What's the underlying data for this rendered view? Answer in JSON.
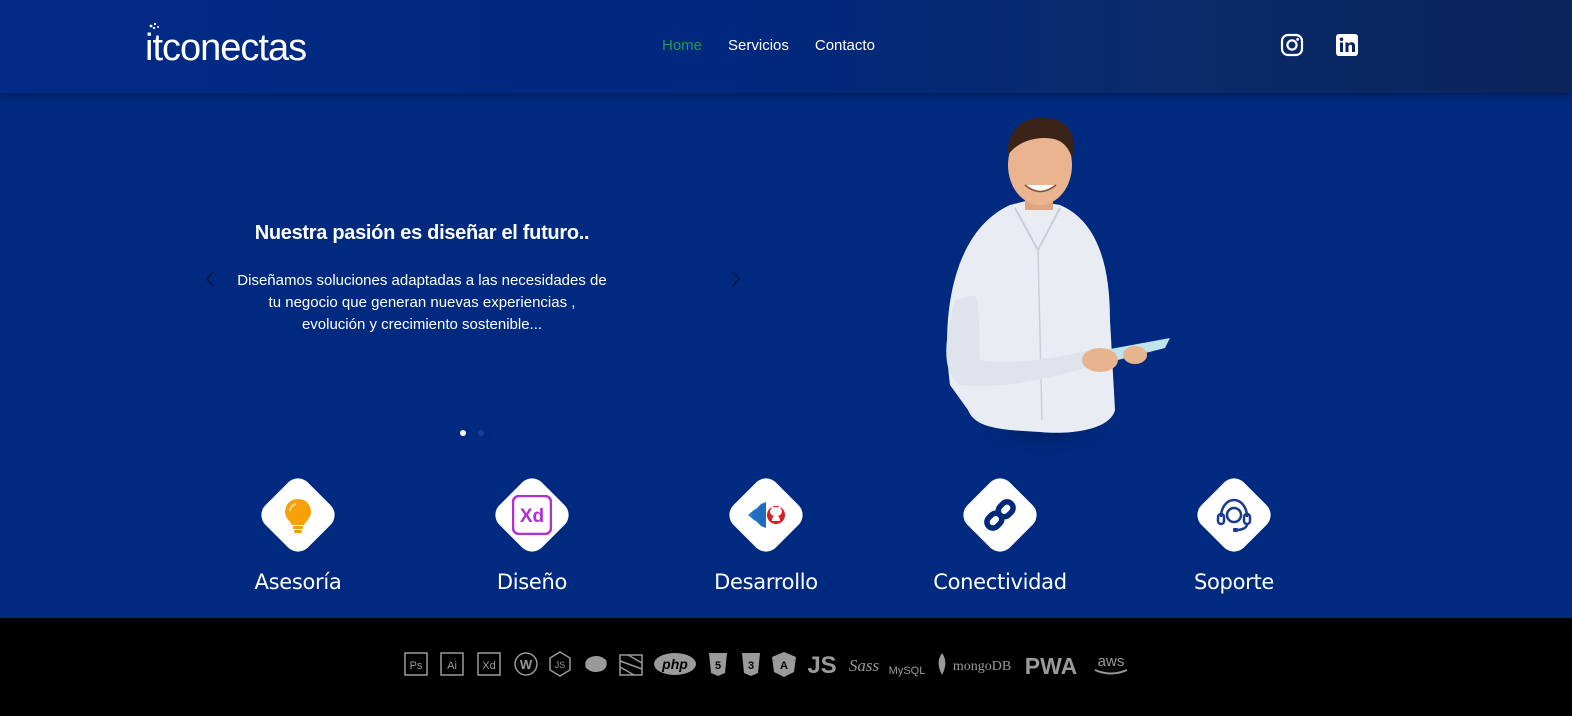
{
  "header": {
    "logo_text": "itconectas",
    "nav": [
      {
        "label": "Home",
        "active": true
      },
      {
        "label": "Servicios",
        "active": false
      },
      {
        "label": "Contacto",
        "active": false
      }
    ],
    "social": [
      "instagram-icon",
      "linkedin-icon"
    ]
  },
  "hero": {
    "title": "Nuestra pasión es diseñar el futuro..",
    "text": "Diseñamos soluciones adaptadas a las necesidades de tu negocio que generan nuevas experiencias , evolución y crecimiento sostenible...",
    "slide_count": 2,
    "active_slide": 1
  },
  "services": [
    {
      "label": "Asesoría",
      "icon": "lightbulb-icon"
    },
    {
      "label": "Diseño",
      "icon": "adobe-xd-icon"
    },
    {
      "label": "Desarrollo",
      "icon": "vscode-github-icon"
    },
    {
      "label": "Conectividad",
      "icon": "link-icon"
    },
    {
      "label": "Soporte",
      "icon": "headset-icon"
    }
  ],
  "footer": {
    "technologies": [
      {
        "name": "Ps",
        "icon": "photoshop-icon"
      },
      {
        "name": "Ai",
        "icon": "illustrator-icon"
      },
      {
        "name": "Xd",
        "icon": "xd-icon"
      },
      {
        "name": "WordPress",
        "icon": "wordpress-icon"
      },
      {
        "name": "Node.js",
        "icon": "nodejs-icon"
      },
      {
        "name": "Python",
        "icon": "python-icon"
      },
      {
        "name": "Bootstrap",
        "icon": "stack-icon"
      },
      {
        "name": "php",
        "icon": "php-icon"
      },
      {
        "name": "HTML5",
        "icon": "html5-icon"
      },
      {
        "name": "CSS3",
        "icon": "css3-icon"
      },
      {
        "name": "Angular",
        "icon": "angular-icon"
      },
      {
        "name": "JS",
        "icon": "js-icon"
      },
      {
        "name": "Sass",
        "icon": "sass-icon"
      },
      {
        "name": "MySQL",
        "icon": "mysql-icon"
      },
      {
        "name": "mongoDB",
        "icon": "mongodb-icon"
      },
      {
        "name": "PWA",
        "icon": "pwa-icon"
      },
      {
        "name": "aws",
        "icon": "aws-icon"
      }
    ]
  },
  "colors": {
    "background": "#002a80",
    "nav_active": "#1f9a4a",
    "footer": "#000000",
    "tile": "#ffffff"
  }
}
